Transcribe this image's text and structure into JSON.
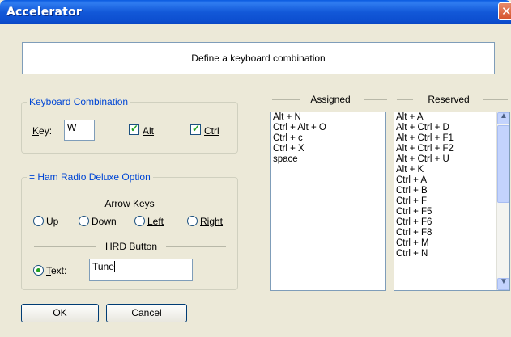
{
  "window": {
    "title": "Accelerator"
  },
  "banner": {
    "text": "Define a keyboard combination"
  },
  "keyboard_combination": {
    "group_title": "Keyboard Combination",
    "key_label": "Key:",
    "key_value": "W",
    "alt_label": "Alt",
    "alt_checked": true,
    "ctrl_label": "Ctrl",
    "ctrl_checked": true
  },
  "ham_radio": {
    "group_title": "= Ham Radio Deluxe Option",
    "arrow_keys_label": "Arrow Keys",
    "arrow_options": [
      "Up",
      "Down",
      "Left",
      "Right"
    ],
    "hrd_button_label": "HRD Button",
    "text_label": "Text:",
    "text_selected": true,
    "text_value": "Tune"
  },
  "assigned": {
    "header": "Assigned",
    "items": [
      "Alt + N",
      "Ctrl + Alt + O",
      "Ctrl + c",
      "Ctrl + X",
      "space"
    ]
  },
  "reserved": {
    "header": "Reserved",
    "items": [
      "Alt + A",
      "Alt + Ctrl + D",
      "Alt + Ctrl + F1",
      "Alt + Ctrl + F2",
      "Alt + Ctrl + U",
      "Alt + K",
      "Ctrl + A",
      "Ctrl + B",
      "Ctrl + F",
      "Ctrl + F5",
      "Ctrl + F6",
      "Ctrl + F8",
      "Ctrl + M",
      "Ctrl + N"
    ]
  },
  "buttons": {
    "ok": "OK",
    "cancel": "Cancel"
  },
  "colors": {
    "titlebar": "#1258d8",
    "group_title": "#0046d5",
    "check": "#21a121",
    "dialog_bg": "#ece9d8"
  },
  "icons": {
    "close": "close-icon",
    "scroll_up": "chevron-up-icon",
    "scroll_down": "chevron-down-icon"
  }
}
